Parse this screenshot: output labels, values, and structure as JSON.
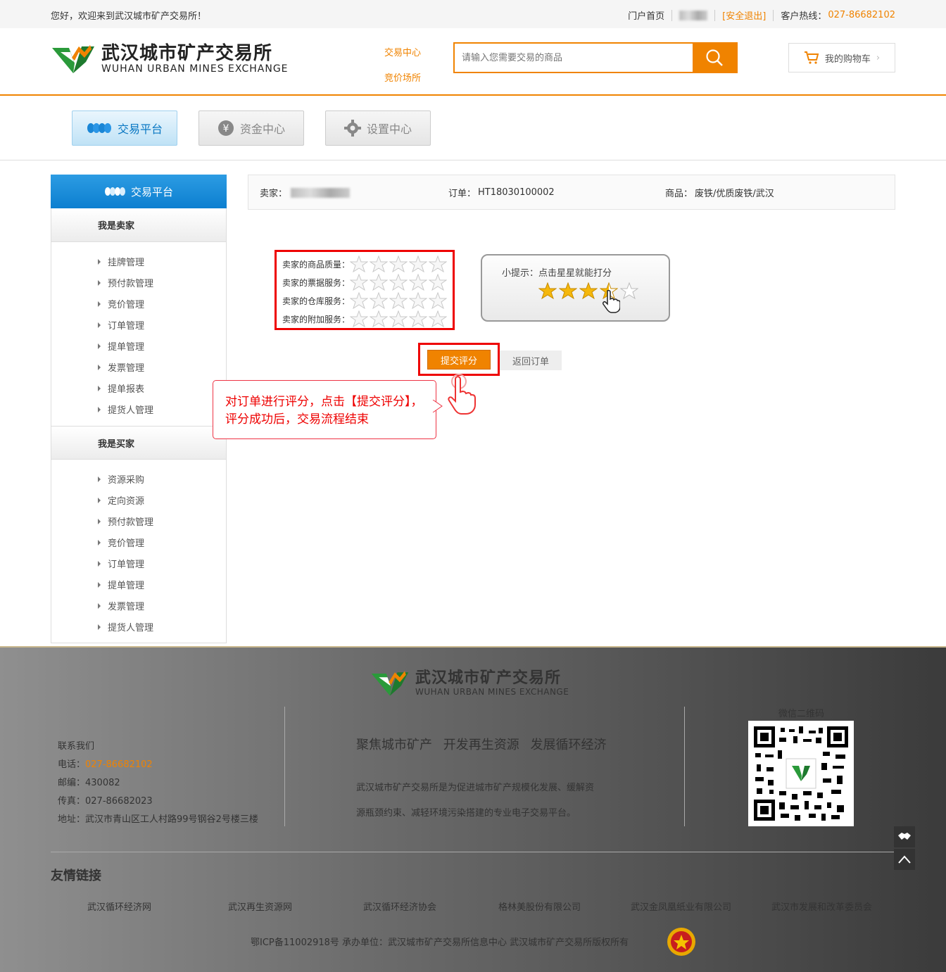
{
  "topbar": {
    "welcome": "您好，欢迎来到武汉城市矿产交易所！",
    "portal_home": "门户首页",
    "logout": "[安全退出]",
    "hotline_label": "客户热线：",
    "hotline": "027-86682102"
  },
  "header": {
    "logo_cn": "武汉城市矿产交易所",
    "logo_en": "WUHAN URBAN MINES EXCHANGE",
    "nav_trade_center": "交易中心",
    "nav_auction": "竞价场所",
    "search_placeholder": "请输入您需要交易的商品",
    "cart_label": "我的购物车"
  },
  "main_tabs": [
    {
      "label": "交易平台",
      "icon": "coins-icon",
      "active": true
    },
    {
      "label": "资金中心",
      "icon": "yen-icon",
      "active": false
    },
    {
      "label": "设置中心",
      "icon": "gear-icon",
      "active": false
    }
  ],
  "sidebar": {
    "title": "交易平台",
    "seller_section": "我是卖家",
    "seller_items": [
      "挂牌管理",
      "预付款管理",
      "竞价管理",
      "订单管理",
      "提单管理",
      "发票管理",
      "提单报表",
      "提货人管理"
    ],
    "buyer_section": "我是买家",
    "buyer_items": [
      "资源采购",
      "定向资源",
      "预付款管理",
      "竞价管理",
      "订单管理",
      "提单管理",
      "发票管理",
      "提货人管理"
    ]
  },
  "order_info": {
    "seller_label": "卖家：",
    "order_label": "订单：",
    "order_no": "HT18030100002",
    "goods_label": "商品：",
    "goods": "废铁/优质废铁/武汉"
  },
  "rating": {
    "rows": [
      {
        "label": "卖家的商品质量：",
        "stars": 5,
        "filled": 0
      },
      {
        "label": "卖家的票据服务：",
        "stars": 5,
        "filled": 0
      },
      {
        "label": "卖家的仓库服务：",
        "stars": 5,
        "filled": 0
      },
      {
        "label": "卖家的附加服务：",
        "stars": 5,
        "filled": 0
      }
    ],
    "tip": "小提示：点击星星就能打分",
    "tip_example_filled": 3.5,
    "submit": "提交评分",
    "back": "返回订单"
  },
  "callout": {
    "line1": "对订单进行评分，点击【提交评分】，",
    "line2": "评分成功后，交易流程结束"
  },
  "footer": {
    "logo_cn": "武汉城市矿产交易所",
    "logo_en": "WUHAN URBAN MINES EXCHANGE",
    "contact_title": "联系我们",
    "phone_label": "电话：",
    "phone": "027-86682102",
    "zip": "邮编：430082",
    "fax": "传真：027-86682023",
    "address": "地址：武汉市青山区工人村路99号钢谷2号楼三楼",
    "slogan": "聚焦城市矿产 开发再生资源 发展循环经济",
    "desc_line1": "武汉城市矿产交易所是为促进城市矿产规模化发展、缓解资",
    "desc_line2": "源瓶颈约束、减轻环境污染搭建的专业电子交易平台。",
    "qr_label": "微信二维码",
    "friend_title": "友情链接",
    "friend_links": [
      "武汉循环经济网",
      "武汉再生资源网",
      "武汉循环经济协会",
      "格林美股份有限公司",
      "武汉金凤凰纸业有限公司",
      "武汉市发展和改革委员会"
    ],
    "copyright": "鄂ICP备11002918号 承办单位：武汉城市矿产交易所信息中心 武汉城市矿产交易所版权所有"
  },
  "colors": {
    "accent": "#f08300",
    "blue": "#0c7fd0",
    "red": "#e00000"
  }
}
